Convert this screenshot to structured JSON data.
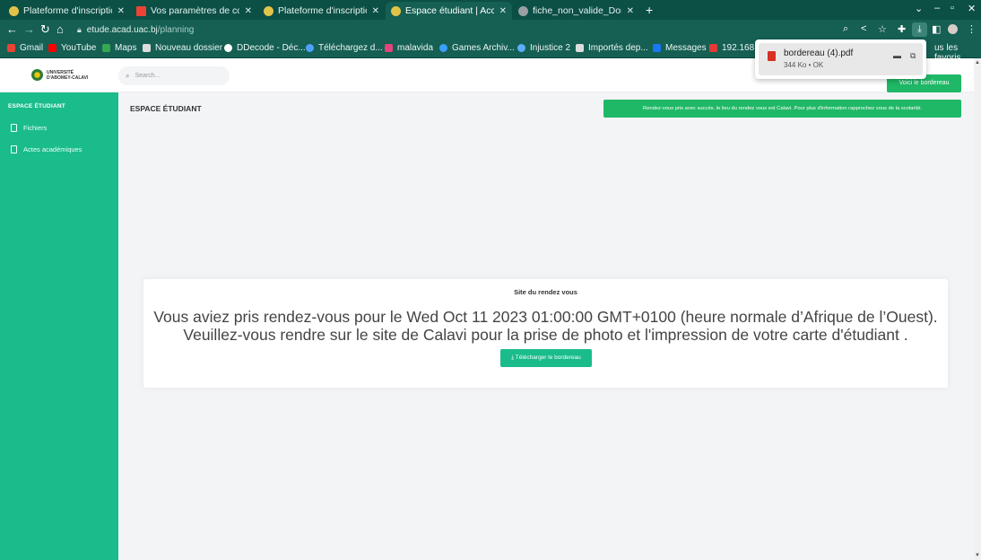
{
  "tabs": [
    {
      "title": "Plateforme d'inscription",
      "favicon_color": "#e2c34a",
      "active": false
    },
    {
      "title": "Vos paramètres de comp",
      "favicon_color": "#ea4335",
      "active": false
    },
    {
      "title": "Plateforme d'inscription",
      "favicon_color": "#e2c34a",
      "active": false
    },
    {
      "title": "Espace étudiant | Accueil",
      "favicon_color": "#e2c34a",
      "active": true
    },
    {
      "title": "fiche_non_valide_Dorian",
      "favicon_color": "#9aa0a6",
      "active": false
    }
  ],
  "address_bar": {
    "host": "etude.acad.uac.bj",
    "path": "/planning"
  },
  "bookmarks": [
    {
      "label": "Gmail",
      "color": "#ea4335"
    },
    {
      "label": "YouTube",
      "color": "#ff0000"
    },
    {
      "label": "Maps",
      "color": "#34a853"
    },
    {
      "label": "Nouveau dossier",
      "color": "#dddddd"
    },
    {
      "label": "DDecode - Déc...",
      "color": "#ffffff"
    },
    {
      "label": "Téléchargez d...",
      "color": "#4fa3ff"
    },
    {
      "label": "malavida",
      "color": "#e0457b"
    },
    {
      "label": "Games Archiv...",
      "color": "#3aa0ff"
    },
    {
      "label": "Injustice 2",
      "color": "#5ab0ff"
    },
    {
      "label": "Importés dep...",
      "color": "#dddddd"
    },
    {
      "label": "Messages",
      "color": "#1877f2"
    },
    {
      "label": "192.168.",
      "color": "#e53935"
    }
  ],
  "all_bookmarks_label": "us les favoris",
  "download": {
    "filename": "bordereau (4).pdf",
    "status": "344 Ko • OK"
  },
  "site": {
    "logo_line1": "UNIVERSITÉ",
    "logo_line2": "D'ABOMEY-CALAVI",
    "search_placeholder": "Search...",
    "sidebar_title": "ESPACE ÉTUDIANT",
    "sidebar_items": [
      "Fichiers",
      "Actes académiques"
    ],
    "content_title": "ESPACE ÉTUDIANT",
    "bordereau_button": "Voici le bordereau",
    "alert": "Rendez-vous pris avec succès. le lieu du rendez vous est Calavi. Pour plus d'information rapprochez vous de la scolarité.",
    "card_title": "Site du rendez vous",
    "card_line1": "Vous aviez pris rendez-vous pour le Wed Oct 11 2023 01:00:00 GMT+0100 (heure normale d’Afrique de l’Ouest).",
    "card_line2": "Veuillez-vous rendre sur le site de Calavi pour la prise de photo et l'impression de votre carte d'étudiant .",
    "download_button": "Télécharger le bordereau"
  }
}
